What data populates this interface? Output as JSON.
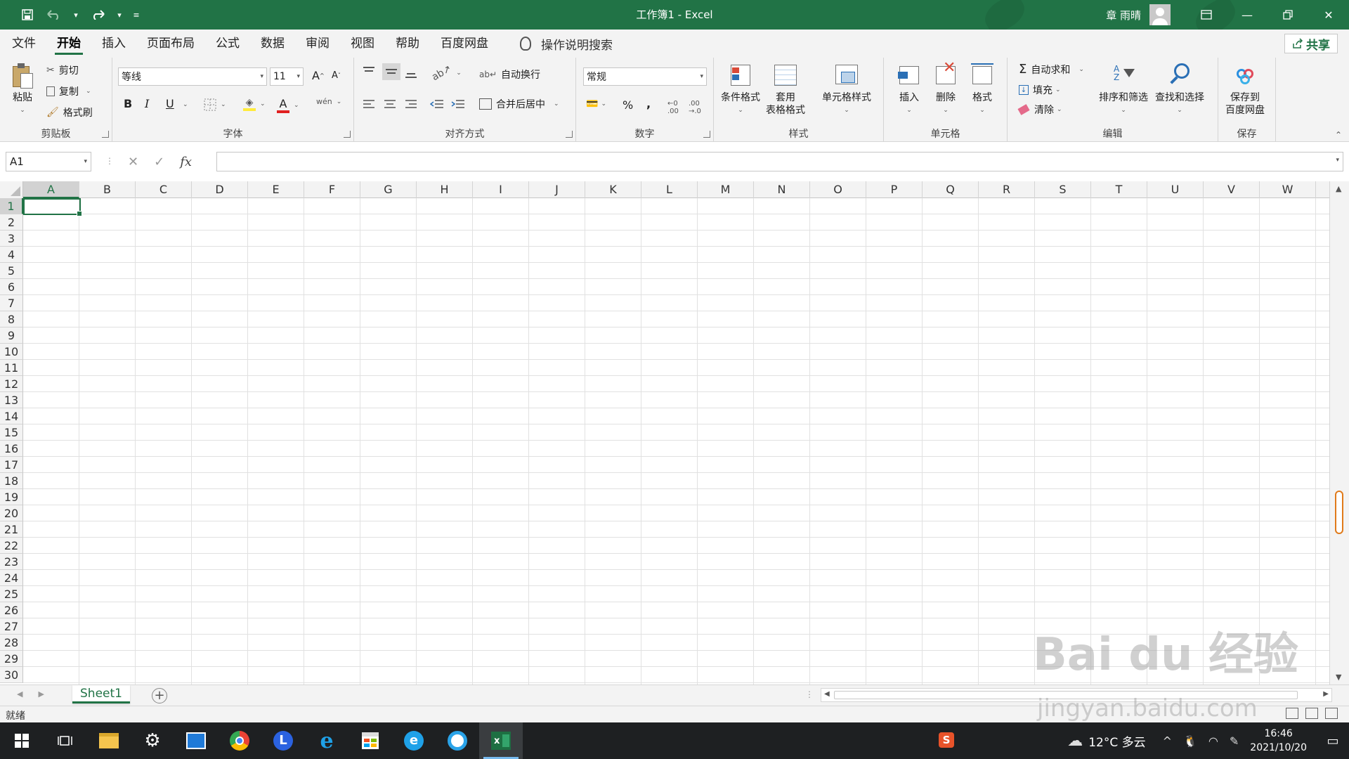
{
  "window": {
    "title": "工作簿1  -  Excel",
    "user": "章 雨晴",
    "accent": "#217346"
  },
  "qat": {
    "save_icon": "save-icon",
    "undo_icon": "undo-icon",
    "redo_icon": "redo-icon",
    "customize": "customize-qat-icon"
  },
  "tabs": [
    {
      "label": "文件"
    },
    {
      "label": "开始"
    },
    {
      "label": "插入"
    },
    {
      "label": "页面布局"
    },
    {
      "label": "公式"
    },
    {
      "label": "数据"
    },
    {
      "label": "审阅"
    },
    {
      "label": "视图"
    },
    {
      "label": "帮助"
    },
    {
      "label": "百度网盘"
    }
  ],
  "tell_me": "操作说明搜索",
  "share": "共享",
  "ribbon": {
    "clipboard": {
      "paste": "粘贴",
      "cut": "剪切",
      "copy": "复制",
      "format_painter": "格式刷",
      "label": "剪贴板"
    },
    "font": {
      "name": "等线",
      "size": "11",
      "bold": "B",
      "italic": "I",
      "underline": "U",
      "grow": "A",
      "shrink": "A",
      "phonetic": "wén",
      "label": "字体"
    },
    "alignment": {
      "wrap": "自动换行",
      "merge": "合并后居中",
      "label": "对齐方式"
    },
    "number": {
      "format": "常规",
      "percent": "%",
      "comma": ",",
      "label": "数字"
    },
    "styles": {
      "conditional": "条件格式",
      "table1": "套用",
      "table2": "表格格式",
      "cell_styles": "单元格样式",
      "label": "样式"
    },
    "cells": {
      "insert": "插入",
      "delete": "删除",
      "format": "格式",
      "label": "单元格"
    },
    "editing": {
      "autosum": "自动求和",
      "fill": "填充",
      "clear": "清除",
      "sort": "排序和筛选",
      "find": "查找和选择",
      "label": "编辑"
    },
    "save": {
      "line1": "保存到",
      "line2": "百度网盘",
      "label": "保存"
    }
  },
  "formula_bar": {
    "name_box": "A1",
    "fx": "fx",
    "cancel": "✕",
    "enter": "✓",
    "content": ""
  },
  "columns": [
    "A",
    "B",
    "C",
    "D",
    "E",
    "F",
    "G",
    "H",
    "I",
    "J",
    "K",
    "L",
    "M",
    "N",
    "O",
    "P",
    "Q",
    "R",
    "S",
    "T",
    "U",
    "V",
    "W"
  ],
  "rows": [
    "1",
    "2",
    "3",
    "4",
    "5",
    "6",
    "7",
    "8",
    "9",
    "10",
    "11",
    "12",
    "13",
    "14",
    "15",
    "16",
    "17",
    "18",
    "19",
    "20",
    "21",
    "22",
    "23",
    "24",
    "25",
    "26",
    "27",
    "28",
    "29",
    "30"
  ],
  "selected": {
    "column": "A",
    "row": "1"
  },
  "sheet": {
    "name": "Sheet1",
    "add": "+"
  },
  "status": {
    "ready": "就绪"
  },
  "taskbar": {
    "weather": "12°C 多云",
    "time": "16:46",
    "date": "2021/10/20"
  },
  "watermark": {
    "line1": "Bai du 经验",
    "line2": "jingyan.baidu.com"
  }
}
